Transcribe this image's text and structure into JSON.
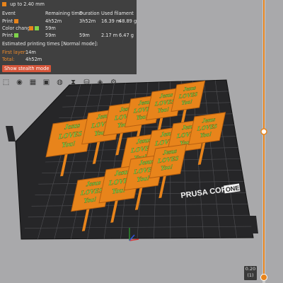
{
  "panel": {
    "header_line": "up to 2.40 mm",
    "columns": {
      "event": "Event",
      "remaining": "Remaining time",
      "duration": "Duration",
      "filament": "Used filament"
    },
    "rows": [
      {
        "event": "Print",
        "remaining": "4h52m",
        "duration": "3h52m",
        "used_length": "16.39 m",
        "used_weight": "48.89 g",
        "swatches": [
          "#e8841b"
        ]
      },
      {
        "event": "Color change",
        "remaining": "59m",
        "duration": "",
        "used_length": "",
        "used_weight": "",
        "swatches": [
          "#e8841b",
          "#7fd34a"
        ]
      },
      {
        "event": "Print",
        "remaining": "59m",
        "duration": "59m",
        "used_length": "2.17 m",
        "used_weight": "6.47 g",
        "swatches": [
          "#7fd34a"
        ]
      }
    ],
    "estimated_title": "Estimated printing times [Normal mode]:",
    "first_layer_label": "First layer:",
    "first_layer_value": "14m",
    "total_label": "Total:",
    "total_value": "4h52m",
    "stealth_button": "Show stealth mode"
  },
  "toolbar": {
    "icons": [
      "perspective-icon",
      "layers-icon",
      "grid-icon",
      "objects-icon",
      "palette-icon",
      "hourglass-icon",
      "extruder-icon",
      "cube-icon",
      "settings-icon"
    ]
  },
  "plate": {
    "logo": "PRUSA CORE",
    "logo_badge": "ONE"
  },
  "tag_text": [
    "Jesus",
    "LOVES",
    "You!"
  ],
  "slider": {
    "value_top": "0.20",
    "value_bottom": "(1)",
    "accent": "#e8841b"
  },
  "colors": {
    "orange": "#e8841b",
    "green": "#7fd34a",
    "bed": "#2a2a2c"
  }
}
